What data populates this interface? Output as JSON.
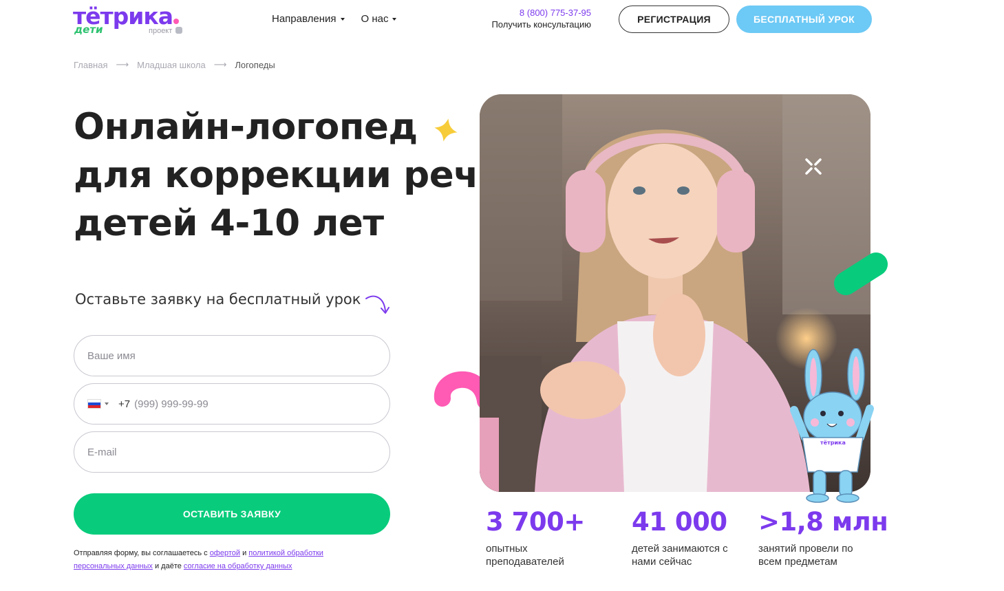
{
  "header": {
    "logo_main": "тётрика",
    "logo_sub": "дети",
    "logo_project": "проект",
    "nav": [
      {
        "label": "Направления"
      },
      {
        "label": "О нас"
      }
    ],
    "phone": "8 (800) 775-37-95",
    "consult": "Получить консультацию",
    "register_label": "РЕГИСТРАЦИЯ",
    "free_lesson_label": "БЕСПЛАТНЫЙ УРОК"
  },
  "breadcrumb": {
    "items": [
      "Главная",
      "Младшая школа",
      "Логопеды"
    ]
  },
  "hero": {
    "title_lines": [
      "Онлайн-логопед",
      "для коррекции речи",
      "детей 4-10 лет"
    ],
    "subtitle": "Оставьте заявку на бесплатный урок"
  },
  "form": {
    "name_placeholder": "Ваше имя",
    "phone_prefix": "+7",
    "phone_placeholder": "(999) 999-99-99",
    "email_placeholder": "E-mail",
    "submit_label": "ОСТАВИТЬ ЗАЯВКУ",
    "consent_1": "Отправляя форму, вы соглашаетесь с ",
    "consent_link_offer": "офертой",
    "consent_2": " и ",
    "consent_link_policy": "политикой обработки персональных данных",
    "consent_3": " и даёте ",
    "consent_link_agree": "согласие на обработку данных"
  },
  "stats": [
    {
      "value": "3 700+",
      "label": "опытных преподавателей"
    },
    {
      "value": "41 000",
      "label": "детей занимаются с нами сейчас"
    },
    {
      "value": ">1,8 млн",
      "label": "занятий провели по всем предметам"
    }
  ],
  "mascot_shirt_text": "тётрика",
  "colors": {
    "accent": "#7c3aed",
    "green": "#08cc7c",
    "sky": "#6dc9f5",
    "pink": "#ff5ab4",
    "yellow": "#f7cc3a"
  },
  "icons": [
    "caret-down-icon",
    "arrow-right-icon",
    "star-decoration-icon",
    "curved-arrow-icon",
    "close-icon",
    "russia-flag-icon",
    "bunny-mascot"
  ]
}
